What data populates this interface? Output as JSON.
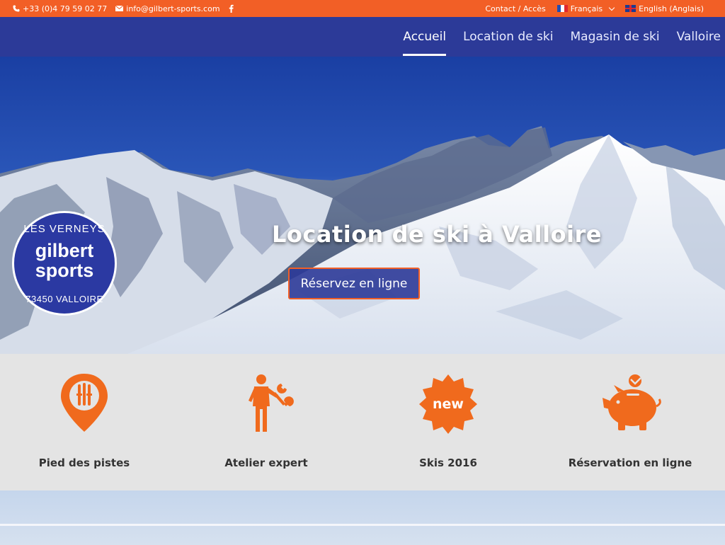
{
  "topbar": {
    "phone": "+33 (0)4 79 59 02 77",
    "email": "info@gilbert-sports.com",
    "social_icon": "facebook-icon",
    "contact": "Contact / Accès",
    "lang_current": "Français",
    "lang_other": "English (Anglais)"
  },
  "nav": {
    "items": [
      "Accueil",
      "Location de ski",
      "Magasin de ski",
      "Valloire"
    ]
  },
  "logo": {
    "top": "LES VERNEYS",
    "line1": "gilbert",
    "line2": "sports",
    "bottom": "73450 VALLOIRE"
  },
  "hero": {
    "title": "Location de ski à Valloire",
    "button": "Réservez en ligne",
    "slides": 3,
    "active_slide": 0
  },
  "features": [
    {
      "icon": "map-pin-ski-icon",
      "label": "Pied des pistes"
    },
    {
      "icon": "mechanic-wrench-icon",
      "label": "Atelier expert"
    },
    {
      "icon": "new-badge-icon",
      "label": "Skis 2016",
      "badge": "new"
    },
    {
      "icon": "piggy-bank-icon",
      "label": "Réservation en ligne"
    }
  ],
  "colors": {
    "accent": "#f25f26",
    "nav_bg": "#2c3a98",
    "feature_bg": "#e4e4e4",
    "icon_orange": "#f06a1d"
  }
}
